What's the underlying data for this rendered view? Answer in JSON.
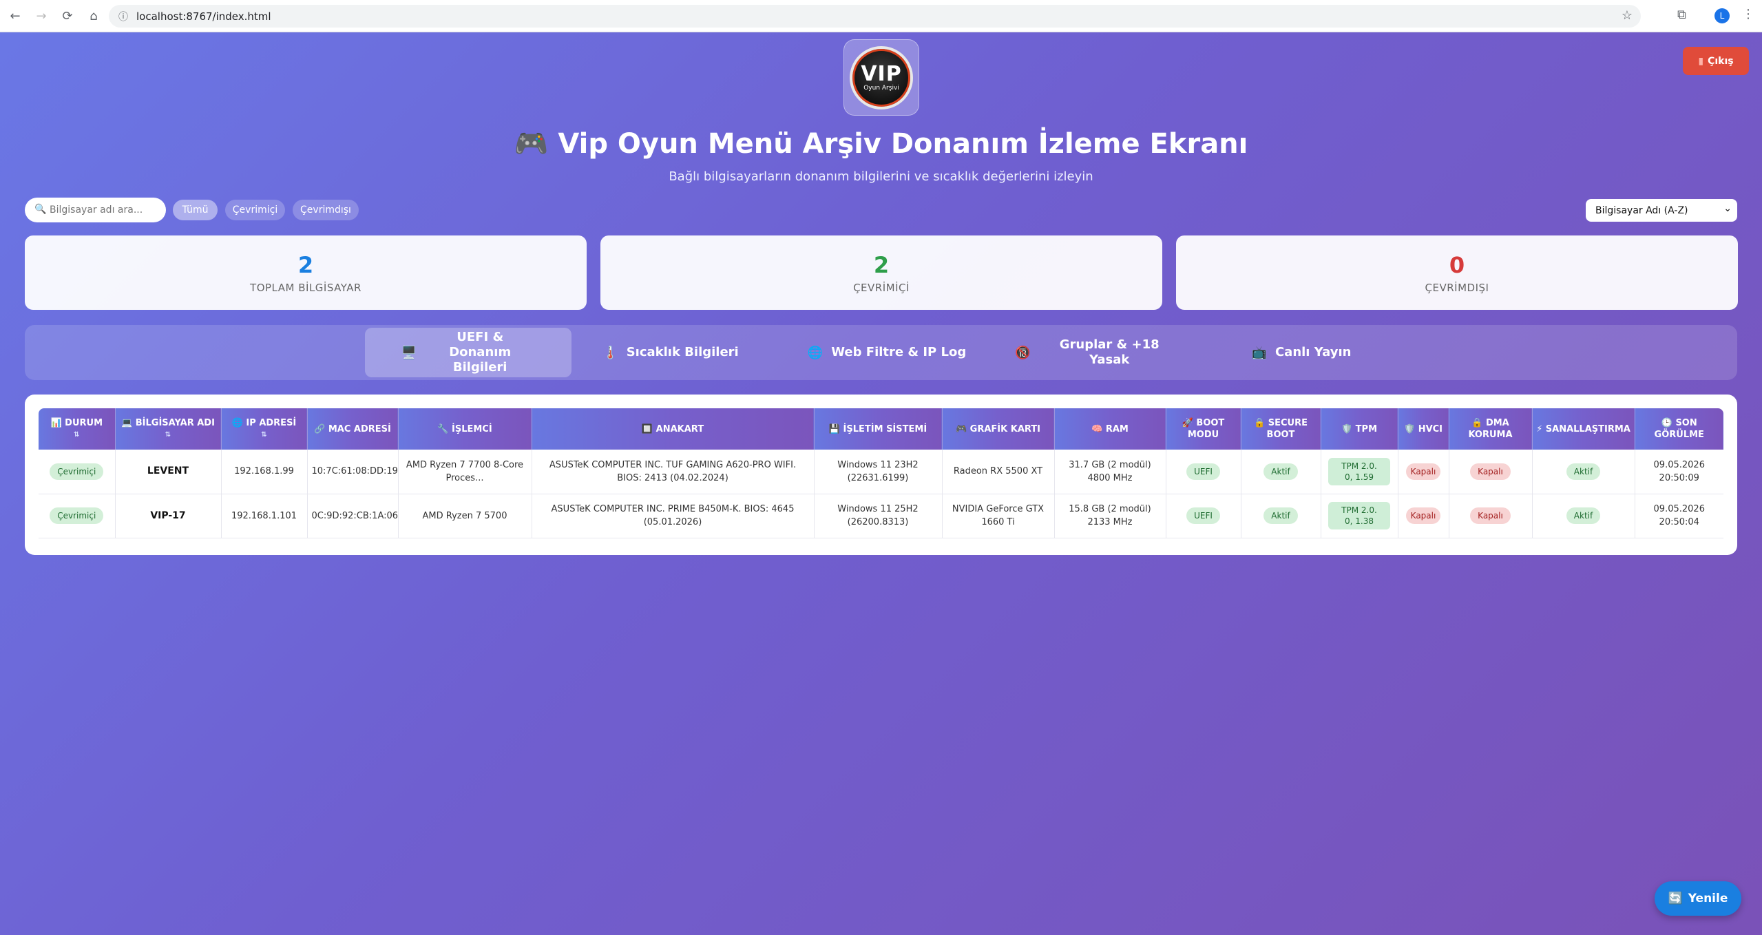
{
  "browser": {
    "url": "localhost:8767/index.html",
    "avatar_letter": "L"
  },
  "logo": {
    "main": "VIP",
    "sub": "Oyun Arşivi"
  },
  "logout_label": "Çıkış",
  "title": "🎮 Vip Oyun Menü Arşiv Donanım İzleme Ekranı",
  "subtitle": "Bağlı bilgisayarların donanım bilgilerini ve sıcaklık değerlerini izleyin",
  "search": {
    "placeholder": "Bilgisayar adı ara..."
  },
  "filters": [
    "Tümü",
    "Çevrimiçi",
    "Çevrimdışı"
  ],
  "sort": {
    "selected": "Bilgisayar Adı (A-Z)"
  },
  "stats": [
    {
      "value": "2",
      "label": "TOPLAM BİLGİSAYAR",
      "color": "#1a7fe0"
    },
    {
      "value": "2",
      "label": "ÇEVRİMİÇİ",
      "color": "#2e9e4a"
    },
    {
      "value": "0",
      "label": "ÇEVRİMDIŞI",
      "color": "#d63a3a"
    }
  ],
  "tabs": [
    {
      "icon": "🖥️",
      "label": "UEFI & Donanım Bilgileri"
    },
    {
      "icon": "🌡️",
      "label": "Sıcaklık Bilgileri"
    },
    {
      "icon": "🌐",
      "label": "Web Filtre & IP Log"
    },
    {
      "icon": "🔞",
      "label": "Gruplar & +18 Yasak"
    },
    {
      "icon": "📺",
      "label": "Canlı Yayın"
    }
  ],
  "table": {
    "headers": [
      "📊 DURUM",
      "💻 BİLGİSAYAR ADI",
      "🌐 IP ADRESİ",
      "🔗 MAC ADRESİ",
      "🔧 İŞLEMCİ",
      "🔲 ANAKART",
      "💾 İŞLETİM SİSTEMİ",
      "🎮 GRAFİK KARTI",
      "🧠 RAM",
      "🚀 BOOT MODU",
      "🔒 SECURE BOOT",
      "🛡️ TPM",
      "🛡️ HVCI",
      "🔒 DMA KORUMA",
      "⚡ SANALLAŞTIRMA",
      "🕒 SON GÖRÜLME"
    ],
    "rows": [
      {
        "status": "Çevrimiçi",
        "name": "LEVENT",
        "ip": "192.168.1.99",
        "mac": "10:7C:61:08:DD:19",
        "cpu": "AMD Ryzen 7 7700 8-Core Proces...",
        "board": "ASUSTeK COMPUTER INC. TUF GAMING A620-PRO WIFI. BIOS: 2413 (04.02.2024)",
        "os": "Windows 11 23H2 (22631.6199)",
        "gpu": "Radeon RX 5500 XT",
        "ram": "31.7 GB (2 modül) 4800 MHz",
        "boot": "UEFI",
        "secure": "Aktif",
        "tpm": "TPM 2.0. 0, 1.59",
        "hvci": "Kapalı",
        "dma": "Kapalı",
        "virt": "Aktif",
        "seen": "09.05.2026 20:50:09"
      },
      {
        "status": "Çevrimiçi",
        "name": "VIP-17",
        "ip": "192.168.1.101",
        "mac": "0C:9D:92:CB:1A:06",
        "cpu": "AMD Ryzen 7 5700",
        "board": "ASUSTeK COMPUTER INC. PRIME B450M-K. BIOS: 4645 (05.01.2026)",
        "os": "Windows 11 25H2 (26200.8313)",
        "gpu": "NVIDIA GeForce GTX 1660 Ti",
        "ram": "15.8 GB (2 modül) 2133 MHz",
        "boot": "UEFI",
        "secure": "Aktif",
        "tpm": "TPM 2.0. 0, 1.38",
        "hvci": "Kapalı",
        "dma": "Kapalı",
        "virt": "Aktif",
        "seen": "09.05.2026 20:50:04"
      }
    ]
  },
  "refresh_label": "Yenile"
}
